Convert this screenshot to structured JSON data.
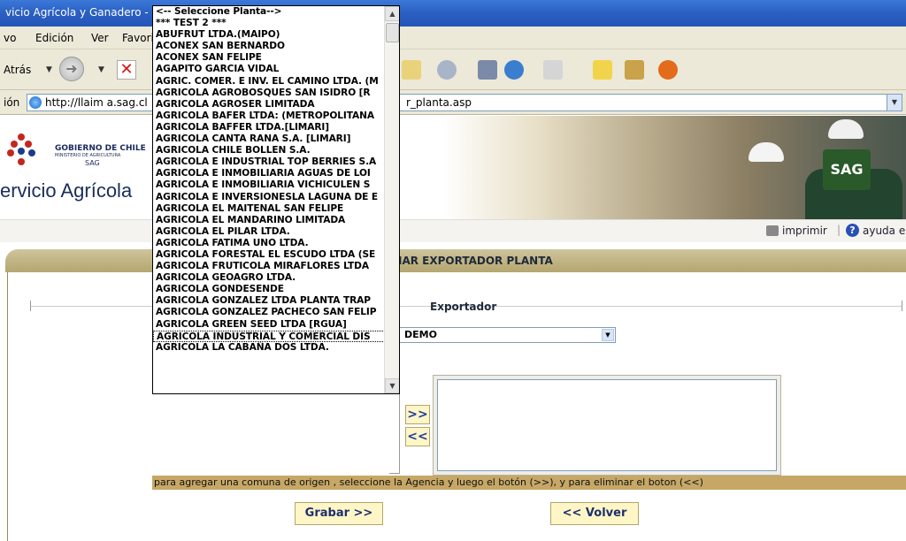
{
  "window": {
    "title": "vicio Agrícola y Ganadero -"
  },
  "menu": {
    "items": [
      "vo",
      "Edición",
      "Ver",
      "Favori"
    ]
  },
  "toolbar": {
    "back_label": "Atrás"
  },
  "address": {
    "label": "ión",
    "url_start": "http://llaim a.sag.cl",
    "url_end": "r_planta.asp"
  },
  "header": {
    "gob_line1": "GOBIERNO DE CHILE",
    "gob_line2": "MINISTERIO DE AGRICULTURA",
    "gob_line3": "SAG",
    "servicio": "ervicio Agrícola",
    "banner_badge": "SAG"
  },
  "utility": {
    "print_label": "imprimir",
    "separator": "|",
    "help_label": "ayuda e"
  },
  "page": {
    "title": "IAR EXPORTADOR PLANTA"
  },
  "form": {
    "exportador_label": "Exportador",
    "exportador_value": "DEMO",
    "add_button": ">>",
    "remove_button": "<<",
    "hint": "para agregar una comuna de origen , seleccione la Agencia y luego el botón (>>), y para eliminar el boton (<<)",
    "grabar_button": "Grabar >>",
    "volver_button": "<< Volver"
  },
  "dropdown": {
    "items": [
      "<-- Seleccione Planta-->",
      "*** TEST 2 ***",
      "ABUFRUT LTDA.(MAIPO)",
      "ACONEX SAN BERNARDO",
      "ACONEX SAN FELIPE",
      "AGAPITO GARCIA VIDAL",
      "AGRIC. COMER. E INV. EL CAMINO LTDA. (M",
      "AGRICOLA AGROBOSQUES SAN ISIDRO [R",
      "AGRICOLA AGROSER LIMITADA",
      "AGRICOLA BAFER LTDA: (METROPOLITANA",
      "AGRICOLA BAFFER LTDA.[LIMARI]",
      "AGRICOLA CANTA RANA S.A. [LIMARI]",
      "AGRICOLA CHILE BOLLEN S.A.",
      "AGRICOLA E INDUSTRIAL TOP BERRIES S.A",
      "AGRICOLA E INMOBILIARIA AGUAS DE LOI",
      "AGRICOLA E INMOBILIARIA VICHICULEN S",
      "AGRICOLA E INVERSIONESLA LAGUNA DE E",
      "AGRICOLA EL MAITENAL SAN FELIPE",
      "AGRICOLA EL MANDARINO LIMITADA",
      "AGRICOLA EL PILAR LTDA.",
      "AGRICOLA FATIMA UNO LTDA.",
      "AGRICOLA FORESTAL EL ESCUDO LTDA (SE",
      "AGRICOLA FRUTICOLA MIRAFLORES LTDA",
      "AGRICOLA GEOAGRO LTDA.",
      "AGRICOLA GONDESENDE",
      "AGRICOLA GONZALEZ LTDA PLANTA TRAP",
      "AGRICOLA GONZALEZ PACHECO SAN FELIP",
      "AGRICOLA GREEN SEED LTDA [RGUA]",
      "AGRICOLA INDUSTRIAL Y COMERCIAL DIS",
      "AGRICOLA LA CABAÑA DOS LTDA."
    ],
    "selected_index": 28
  },
  "colors": {
    "title_bar": "#2a5fc1",
    "chrome": "#ece9d8",
    "page_bar": "#b5a66f",
    "hint_bar": "#c6a765",
    "button_bg": "#fff6c7",
    "brand_navy": "#1a2d5a"
  }
}
